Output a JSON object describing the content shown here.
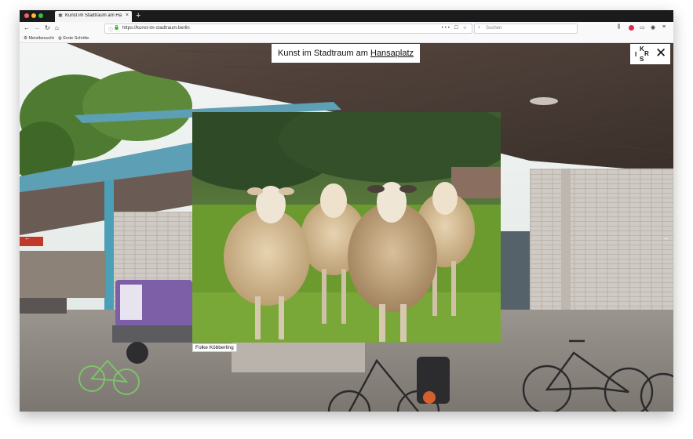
{
  "browser": {
    "tab": {
      "title": "Kunst im Stadtraum am Hans…"
    },
    "new_tab": "+",
    "url": "https://kunst-im-stadtraum.berlin",
    "url_actions": "••• ☐ ☆",
    "search_placeholder": "Suchen"
  },
  "bookmarks": [
    "Meistbesucht",
    "Erste Schritte"
  ],
  "page": {
    "title_prefix": "Kunst im Stadtraum am ",
    "title_link": "Hansaplatz",
    "logo_letters": [
      "I",
      "K",
      "S",
      "R"
    ],
    "close": "✕",
    "credit": "Folke Köbberling",
    "prev": "←",
    "next": "→"
  },
  "colors": {
    "tab_bar": "#1b1b1d",
    "nav_bar": "#f9f9fa",
    "pillar_teal": "#4b9fb7",
    "grass": "#5f8f2a"
  },
  "icons": [
    "back-icon",
    "forward-icon",
    "reload-icon",
    "home-icon",
    "info-icon",
    "lock-icon",
    "pocket-icon",
    "star-icon",
    "search-icon",
    "library-icon",
    "sidebar-icon",
    "account-icon",
    "menu-icon"
  ]
}
